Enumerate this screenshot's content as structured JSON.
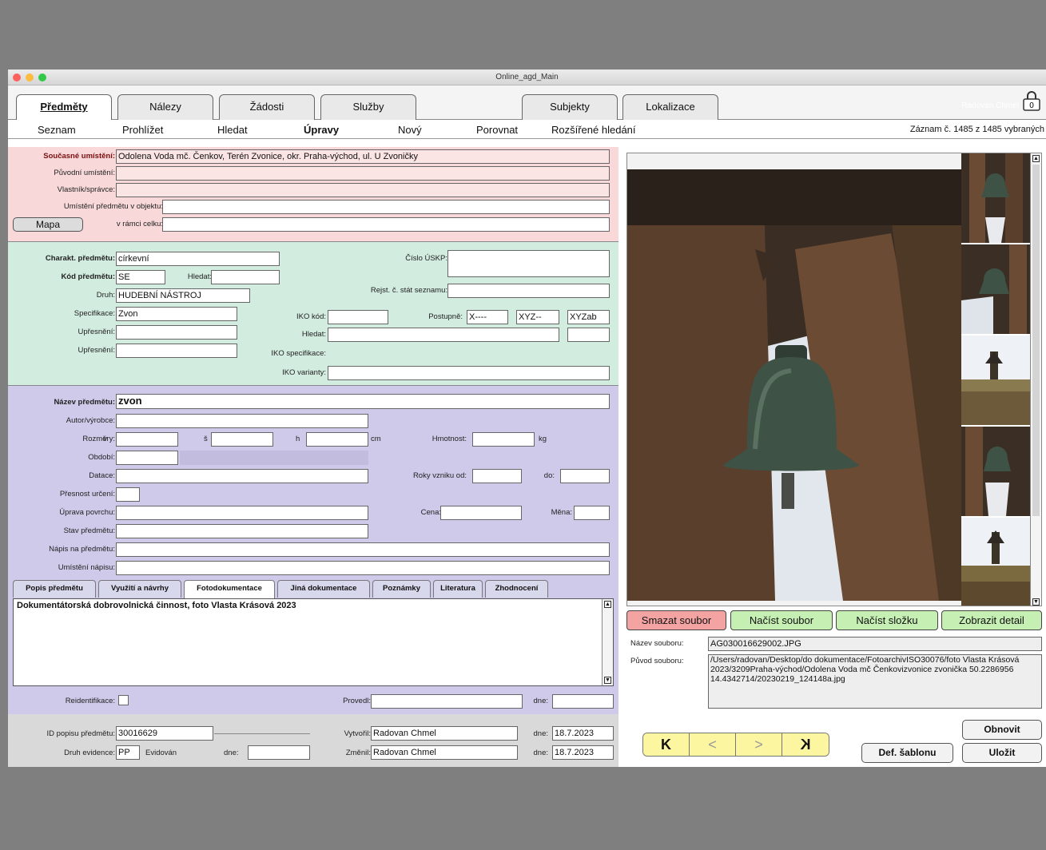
{
  "window": {
    "title": "Online_agd_Main",
    "user": "Radovan Chmel",
    "lock_count": "0"
  },
  "tabs": [
    {
      "label": "Předměty"
    },
    {
      "label": "Nálezy"
    },
    {
      "label": "Žádosti"
    },
    {
      "label": "Služby"
    },
    {
      "label": "Subjekty"
    },
    {
      "label": "Lokalizace"
    }
  ],
  "menu": {
    "items": [
      "Seznam",
      "Prohlížet",
      "Hledat",
      "Úpravy",
      "Nový",
      "Porovnat",
      "Rozšířené hledání"
    ],
    "record": "Záznam č. 1485 z 1485 vybraných"
  },
  "location": {
    "current_label": "Současné umístění:",
    "current": "Odolena Voda mč. Čenkov, Terén Zvonice, okr. Praha-východ, ul. U Zvoničky",
    "original_label": "Původní umístění:",
    "owner_label": "Vlastník/správce:",
    "in_object_label": "Umístění předmětu v objektu:",
    "within_label": "v rámci celku:",
    "map_button": "Mapa"
  },
  "char": {
    "char_label": "Charakt. předmětu:",
    "char": "církevní",
    "code_label": "Kód předmětu:",
    "code": "SE",
    "search_label": "Hledat:",
    "kind_label": "Druh:",
    "kind": "HUDEBNÍ NÁSTROJ",
    "spec_label": "Specifikace:",
    "spec": "Zvon",
    "refine1_label": "Upřesnění:",
    "refine2_label": "Upřesnění:",
    "uskp_label": "Číslo ÚSKP:",
    "rejst_label": "Rejst. č. stát seznamu:",
    "iko_label": "IKO kód:",
    "postupne_label": "Postupně:",
    "post1": "X----",
    "post2": "XYZ--",
    "post3": "XYZab",
    "iko_search_label": "Hledat:",
    "iko_spec_label": "IKO specifikace:",
    "iko_var_label": "IKO varianty:"
  },
  "item": {
    "name_label": "Název předmětu:",
    "name": "zvon",
    "author_label": "Autor/výrobce:",
    "dims_label": "Rozměry:",
    "v_label": "v",
    "s_label": "š",
    "h_label": "h",
    "cm": "cm",
    "weight_label": "Hmotnost:",
    "kg": "kg",
    "period_label": "Období:",
    "dating_label": "Datace:",
    "years_label": "Roky vzniku od:",
    "to_label": "do:",
    "precision_label": "Přesnost určení:",
    "surface_label": "Úprava povrchu:",
    "price_label": "Cena:",
    "currency_label": "Měna:",
    "state_label": "Stav předmětu:",
    "inscription_label": "Nápis na předmětu:",
    "inscr_place_label": "Umístění nápisu:"
  },
  "subtabs": [
    {
      "label": "Popis předmětu"
    },
    {
      "label": "Využití a návrhy"
    },
    {
      "label": "Fotodokumentace"
    },
    {
      "label": "Jiná dokumentace"
    },
    {
      "label": "Poznámky"
    },
    {
      "label": "Literatura"
    },
    {
      "label": "Zhodnocení"
    }
  ],
  "photodoc_text": "Dokumentátorská dobrovolnická činnost, foto Vlasta Krásová 2023",
  "reident": {
    "label": "Reidentifikace:",
    "done_label": "Provedl:",
    "date_label": "dne:"
  },
  "footer": {
    "id_label": "ID popisu předmětu:",
    "id": "30016629",
    "created_label": "Vytvořil:",
    "created_by": "Radovan Chmel",
    "created_date_label": "dne:",
    "created_date": "18.7.2023",
    "evid_label": "Druh evidence:",
    "evid": "PP",
    "evid_state": "Evidován",
    "evid_date_label": "dne:",
    "changed_label": "Změnil:",
    "changed_by": "Radovan Chmel",
    "changed_date_label": "dne:",
    "changed_date": "18.7.2023"
  },
  "photo": {
    "delete": "Smazat soubor",
    "load_file": "Načíst soubor",
    "load_folder": "Načíst složku",
    "show_detail": "Zobrazit detail",
    "filename_label": "Název souboru:",
    "filename": "AG030016629002.JPG",
    "origin_label": "Původ souboru:",
    "origin": "/Users/radovan/Desktop/do dokumentace/FotoarchivISO30076/foto Vlasta Krásová 2023/3209Praha-východ/Odolena Voda mč Čenkovizvonice zvonička 50.2286956 14.4342714/20230219_124148a.jpg"
  },
  "nav": {
    "first": "K",
    "prev": "<",
    "next": ">",
    "last": "K",
    "refresh": "Obnovit",
    "save": "Uložit",
    "template": "Def. šablonu"
  },
  "colors": {
    "pink": "#f8d8d8",
    "green": "#d3ece0",
    "lavender": "#cfcaea",
    "delete_bg": "#f4a3a3",
    "green_btn": "#c6efb4",
    "nav_bg": "#fdf6a0"
  }
}
